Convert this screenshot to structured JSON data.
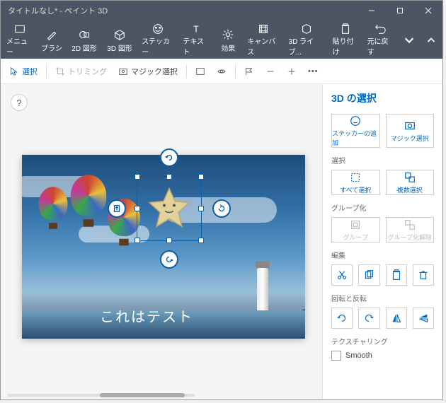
{
  "title": "タイトルなし* - ペイント 3D",
  "ribbon": {
    "menu": "メニュー",
    "brush": "ブラシ",
    "shapes2d": "2D 図形",
    "shapes3d": "3D 図形",
    "sticker": "ステッカー",
    "text": "テキスト",
    "effects": "効果",
    "canvas": "キャンバス",
    "lib3d": "3D ライブ...",
    "paste": "貼り付け",
    "undo": "元に戻す"
  },
  "subbar": {
    "select": "選択",
    "trimming": "トリミング",
    "magic": "マジック選択"
  },
  "canvas_text": "これはテスト",
  "help_label": "?",
  "panel": {
    "title": "3D の選択",
    "add_sticker": "ステッカーの追加",
    "magic_select": "マジック選択",
    "section_select": "選択",
    "select_all": "すべて選択",
    "multi_select": "複数選択",
    "section_group": "グループ化",
    "group": "グループ",
    "ungroup": "グループ化解除",
    "section_edit": "編集",
    "section_rotflip": "回転と反転",
    "section_texturing": "テクスチャリング",
    "smooth": "Smooth"
  }
}
